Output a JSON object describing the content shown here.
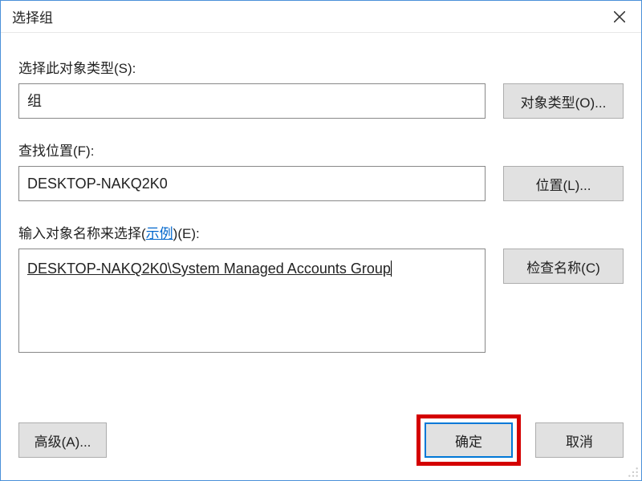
{
  "window": {
    "title": "选择组"
  },
  "labels": {
    "object_type_label": "选择此对象类型(S):",
    "location_label": "查找位置(F):",
    "enter_names_prefix": "输入对象名称来选择(",
    "enter_names_link": "示例",
    "enter_names_suffix": ")(E):"
  },
  "fields": {
    "object_type_value": "组",
    "location_value": "DESKTOP-NAKQ2K0",
    "object_name_value": "DESKTOP-NAKQ2K0\\System Managed Accounts Group"
  },
  "buttons": {
    "object_types": "对象类型(O)...",
    "locations": "位置(L)...",
    "check_names": "检查名称(C)",
    "advanced": "高级(A)...",
    "ok": "确定",
    "cancel": "取消"
  }
}
